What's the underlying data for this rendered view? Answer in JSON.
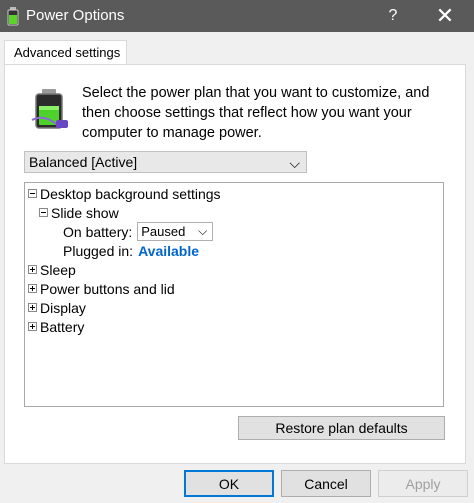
{
  "window": {
    "title": "Power Options",
    "help_glyph": "?",
    "close_glyph": "✕"
  },
  "tab": {
    "label": "Advanced settings"
  },
  "description": "Select the power plan that you want to customize, and then choose settings that reflect how you want your computer to manage power.",
  "plan_select": {
    "value": "Balanced [Active]",
    "chevron": "⌵"
  },
  "tree": {
    "desktop_background": "Desktop background settings",
    "slide_show": "Slide show",
    "on_battery_label": "On battery:",
    "on_battery_value": "Paused",
    "dropdown_chevron": "⌵",
    "plugged_in_label": "Plugged in:",
    "plugged_in_value": "Available",
    "sleep": "Sleep",
    "power_buttons": "Power buttons and lid",
    "display": "Display",
    "battery": "Battery"
  },
  "buttons": {
    "restore": "Restore plan defaults",
    "ok": "OK",
    "cancel": "Cancel",
    "apply": "Apply"
  },
  "colors": {
    "titlebar": "#5a5a5a",
    "link": "#0066cc",
    "focus": "#0078d7"
  }
}
